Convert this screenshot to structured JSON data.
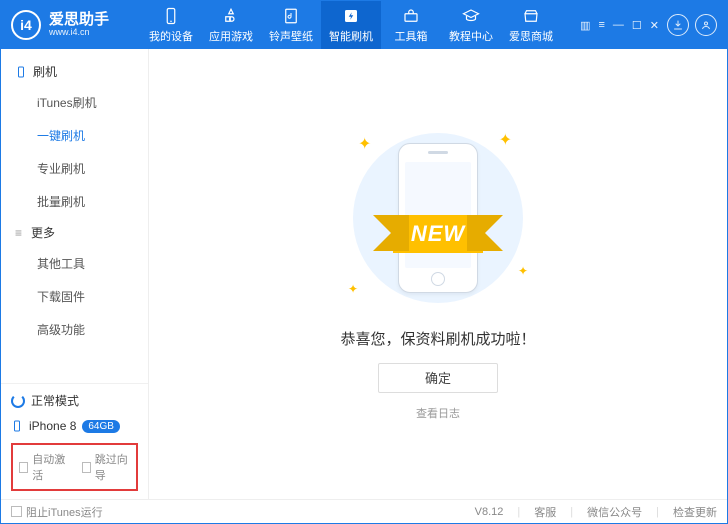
{
  "app": {
    "name": "爱思助手",
    "url": "www.i4.cn",
    "logo_text": "i4"
  },
  "titlebar": {
    "tabs": [
      {
        "label": "我的设备"
      },
      {
        "label": "应用游戏"
      },
      {
        "label": "铃声壁纸"
      },
      {
        "label": "智能刷机"
      },
      {
        "label": "工具箱"
      },
      {
        "label": "教程中心"
      },
      {
        "label": "爱思商城"
      }
    ]
  },
  "sidebar": {
    "sections": [
      {
        "title": "刷机",
        "items": [
          {
            "label": "iTunes刷机"
          },
          {
            "label": "一键刷机"
          },
          {
            "label": "专业刷机"
          },
          {
            "label": "批量刷机"
          }
        ]
      },
      {
        "title": "更多",
        "items": [
          {
            "label": "其他工具"
          },
          {
            "label": "下载固件"
          },
          {
            "label": "高级功能"
          }
        ]
      }
    ],
    "mode_label": "正常模式",
    "device": {
      "name": "iPhone 8",
      "capacity": "64GB"
    },
    "checks": {
      "auto_activate": "自动激活",
      "skip_guide": "跳过向导"
    }
  },
  "main": {
    "ribbon_text": "NEW",
    "success_text": "恭喜您，保资料刷机成功啦！",
    "ok_label": "确定",
    "view_log": "查看日志"
  },
  "status": {
    "block_itunes": "阻止iTunes运行",
    "version": "V8.12",
    "support": "客服",
    "wechat": "微信公众号",
    "update": "检查更新"
  }
}
